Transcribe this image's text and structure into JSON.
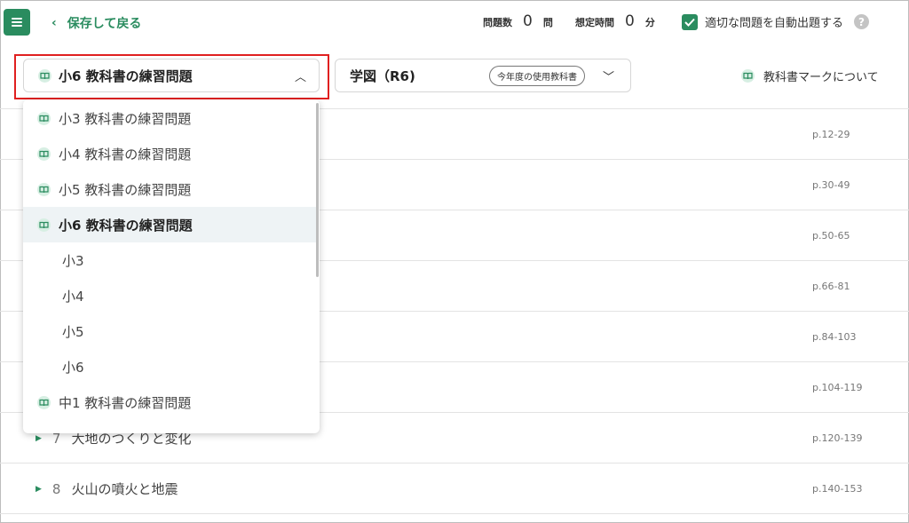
{
  "header": {
    "back_label": "保存して戻る",
    "question_count_label": "問題数",
    "question_count_value": "0",
    "question_count_unit": "問",
    "estimated_time_label": "想定時間",
    "estimated_time_value": "0",
    "estimated_time_unit": "分",
    "auto_assign_label": "適切な問題を自動出題する",
    "help_glyph": "?"
  },
  "grade_select": {
    "value": "小6 教科書の練習問題"
  },
  "publisher_select": {
    "value": "学図（R6)",
    "badge": "今年度の使用教科書"
  },
  "textbook_mark_label": "教科書マークについて",
  "dropdown": {
    "options": [
      {
        "label": "小3 教科書の練習問題",
        "icon": true,
        "selected": false
      },
      {
        "label": "小4 教科書の練習問題",
        "icon": true,
        "selected": false
      },
      {
        "label": "小5 教科書の練習問題",
        "icon": true,
        "selected": false
      },
      {
        "label": "小6 教科書の練習問題",
        "icon": true,
        "selected": true
      },
      {
        "label": "小3",
        "icon": false,
        "selected": false
      },
      {
        "label": "小4",
        "icon": false,
        "selected": false
      },
      {
        "label": "小5",
        "icon": false,
        "selected": false
      },
      {
        "label": "小6",
        "icon": false,
        "selected": false
      },
      {
        "label": "中1 教科書の練習問題",
        "icon": true,
        "selected": false
      }
    ]
  },
  "units": [
    {
      "pages": "p.12-29"
    },
    {
      "pages": "p.30-49"
    },
    {
      "pages": "p.50-65"
    },
    {
      "pages": "p.66-81"
    },
    {
      "pages": "p.84-103"
    },
    {
      "pages": "p.104-119"
    },
    {
      "number": "7",
      "title": "大地のつくりと変化",
      "pages": "p.120-139"
    },
    {
      "number": "8",
      "title": "火山の噴火と地震",
      "pages": "p.140-153"
    }
  ],
  "colors": {
    "accent": "#2a8c5f",
    "highlight_border": "#e02020",
    "selected_bg": "#eef3f5"
  }
}
